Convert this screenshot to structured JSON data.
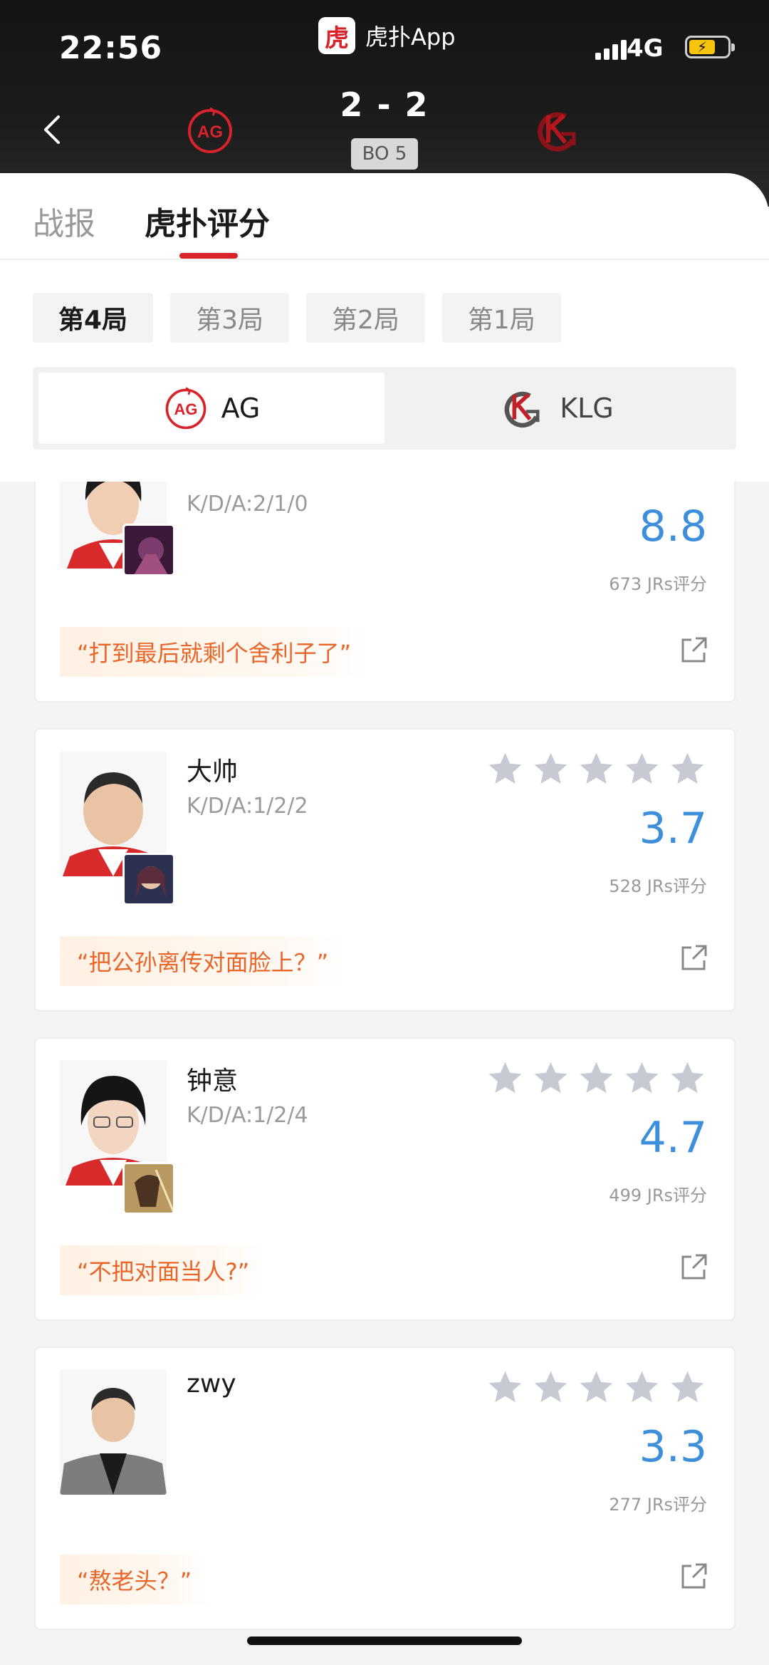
{
  "status_bar": {
    "time": "22:56",
    "app_logo_text": "虎",
    "app_name": "虎扑App",
    "network": "4G"
  },
  "match": {
    "team_left": "AG",
    "team_right": "KLG",
    "score": "2 - 2",
    "format": "BO 5"
  },
  "tabs": [
    {
      "label": "战报",
      "active": false
    },
    {
      "label": "虎扑评分",
      "active": true
    }
  ],
  "games": [
    {
      "label": "第4局",
      "active": true
    },
    {
      "label": "第3局",
      "active": false
    },
    {
      "label": "第2局",
      "active": false
    },
    {
      "label": "第1局",
      "active": false
    }
  ],
  "team_switch": [
    {
      "label": "AG",
      "active": true
    },
    {
      "label": "KLG",
      "active": false
    }
  ],
  "players": [
    {
      "name": "",
      "kda": "K/D/A:2/1/0",
      "rating": "8.8",
      "votes": "673 JRs评分",
      "quote": "“打到最后就剩个舍利子了”",
      "stars_filled": 0
    },
    {
      "name": "大帅",
      "kda": "K/D/A:1/2/2",
      "rating": "3.7",
      "votes": "528 JRs评分",
      "quote": "“把公孙离传对面脸上？”",
      "stars_filled": 0
    },
    {
      "name": "钟意",
      "kda": "K/D/A:1/2/4",
      "rating": "4.7",
      "votes": "499 JRs评分",
      "quote": "“不把对面当人?”",
      "stars_filled": 0
    },
    {
      "name": "zwy",
      "kda": "",
      "rating": "3.3",
      "votes": "277 JRs评分",
      "quote": "“熬老头？”",
      "stars_filled": 0
    }
  ],
  "colors": {
    "accent_red": "#d8232a",
    "rating_blue": "#3d8fdc",
    "quote_orange": "#e9662a",
    "star_gray": "#c8cad3"
  },
  "icons": [
    "back-arrow-icon",
    "ag-logo-icon",
    "klg-logo-icon",
    "star-icon",
    "share-icon"
  ]
}
